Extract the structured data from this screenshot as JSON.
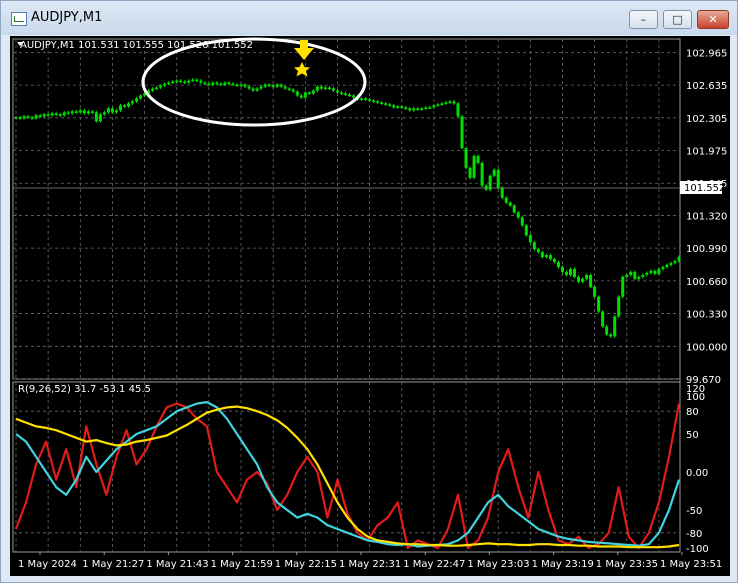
{
  "window": {
    "title": "AUDJPY,M1",
    "minimize_glyph": "–",
    "maximize_glyph": "□",
    "close_glyph": "✕"
  },
  "chart_data": [
    {
      "type": "candlestick",
      "title": "AUDJPY,M1  101.531 101.555 101.526 101.552",
      "ylim": [
        99.67,
        103.1
      ],
      "y_ticks": [
        "102.965",
        "102.635",
        "102.305",
        "101.975",
        "101.645",
        "101.320",
        "100.990",
        "100.660",
        "100.330",
        "100.000",
        "99.670"
      ],
      "current_price": "101.552",
      "series": [
        {
          "color": "#00e000",
          "x": [
            0,
            4,
            8,
            12,
            16,
            20,
            24,
            28,
            32,
            36,
            40,
            44,
            48,
            52,
            56,
            60,
            64,
            68,
            72,
            76,
            80,
            84,
            88,
            92,
            96,
            100,
            104,
            108,
            112,
            116,
            120,
            124,
            128,
            132,
            136,
            140,
            144,
            148,
            152,
            156,
            160,
            164,
            168,
            172,
            176,
            180,
            184,
            188,
            192,
            196,
            200,
            204,
            208,
            212,
            216,
            220,
            224,
            228,
            232,
            236,
            240,
            244,
            248,
            252,
            256,
            260,
            264,
            268,
            272,
            276,
            280,
            284,
            288,
            292,
            296,
            300,
            304,
            308,
            312,
            316,
            320,
            324,
            328,
            332,
            336,
            340,
            344,
            348,
            352,
            356,
            360,
            364,
            368,
            372,
            376,
            380,
            384,
            388,
            392,
            396,
            400,
            404,
            408,
            412,
            416,
            420,
            424,
            428,
            432,
            436,
            440,
            444,
            448,
            452,
            456,
            460,
            464,
            468,
            472,
            476,
            480,
            484,
            488,
            492,
            496,
            500,
            504,
            508,
            512,
            516,
            520,
            524,
            528,
            532,
            536,
            540,
            544,
            548,
            552,
            556,
            560,
            564,
            568,
            572,
            576,
            580,
            584,
            588,
            592,
            596,
            600,
            604,
            608,
            612,
            616,
            620,
            624,
            628,
            632,
            636,
            640,
            644,
            648,
            652,
            656,
            660
          ],
          "values": [
            102.31,
            102.3,
            102.32,
            102.31,
            102.3,
            102.33,
            102.32,
            102.34,
            102.33,
            102.35,
            102.34,
            102.33,
            102.36,
            102.35,
            102.37,
            102.36,
            102.38,
            102.35,
            102.37,
            102.36,
            102.27,
            102.34,
            102.36,
            102.4,
            102.36,
            102.38,
            102.43,
            102.42,
            102.45,
            102.47,
            102.5,
            102.53,
            102.55,
            102.58,
            102.6,
            102.61,
            102.63,
            102.65,
            102.66,
            102.67,
            102.68,
            102.67,
            102.66,
            102.68,
            102.69,
            102.68,
            102.66,
            102.65,
            102.64,
            102.66,
            102.65,
            102.64,
            102.66,
            102.65,
            102.64,
            102.63,
            102.64,
            102.62,
            102.6,
            102.58,
            102.6,
            102.62,
            102.64,
            102.63,
            102.62,
            102.64,
            102.62,
            102.6,
            102.59,
            102.57,
            102.53,
            102.51,
            102.56,
            102.55,
            102.58,
            102.62,
            102.6,
            102.61,
            102.6,
            102.58,
            102.56,
            102.55,
            102.54,
            102.53,
            102.51,
            102.49,
            102.5,
            102.49,
            102.48,
            102.47,
            102.46,
            102.45,
            102.44,
            102.43,
            102.41,
            102.42,
            102.41,
            102.4,
            102.38,
            102.4,
            102.39,
            102.4,
            102.41,
            102.41,
            102.43,
            102.44,
            102.45,
            102.46,
            102.47,
            102.45,
            102.32,
            102.0,
            101.8,
            101.7,
            101.92,
            101.85,
            101.62,
            101.58,
            101.72,
            101.78,
            101.6,
            101.5,
            101.45,
            101.42,
            101.35,
            101.3,
            101.22,
            101.12,
            101.05,
            100.98,
            100.95,
            100.9,
            100.92,
            100.88,
            100.85,
            100.8,
            100.75,
            100.72,
            100.78,
            100.7,
            100.65,
            100.68,
            100.72,
            100.6,
            100.5,
            100.35,
            100.2,
            100.12,
            100.1,
            100.3,
            100.5,
            100.7,
            100.72,
            100.75,
            100.68,
            100.7,
            100.72,
            100.74,
            100.76,
            100.73,
            100.78,
            100.8,
            100.82,
            100.84,
            100.86,
            100.9
          ]
        }
      ],
      "annotation": {
        "shape": "ellipse",
        "arrow_color": "#ffe000",
        "star_color": "#ffe000"
      }
    },
    {
      "type": "line",
      "title": "R(9,26,52) 31.7 -53.1 45.5",
      "ylim": [
        -100,
        100
      ],
      "y_ticks": [
        "120",
        "100",
        "80",
        "50",
        "0.00",
        "-50",
        "-80",
        "-100"
      ],
      "x_ticks": [
        "1 May 2024",
        "1 May 21:27",
        "1 May 21:43",
        "1 May 21:59",
        "1 May 22:15",
        "1 May 22:31",
        "1 May 22:47",
        "1 May 23:03",
        "1 May 23:19",
        "1 May 23:35",
        "1 May 23:51"
      ],
      "series": [
        {
          "color": "#e31b1b",
          "x": [
            0,
            10,
            20,
            30,
            40,
            50,
            60,
            70,
            80,
            90,
            100,
            110,
            120,
            130,
            140,
            150,
            160,
            170,
            180,
            190,
            200,
            210,
            220,
            230,
            240,
            250,
            260,
            270,
            280,
            290,
            300,
            310,
            320,
            330,
            340,
            350,
            360,
            370,
            380,
            390,
            400,
            410,
            420,
            430,
            440,
            450,
            460,
            470,
            480,
            490,
            500,
            510,
            520,
            530,
            540,
            550,
            560,
            570,
            580,
            590,
            600,
            610,
            620,
            630,
            640,
            650,
            660
          ],
          "values": [
            -75,
            -40,
            10,
            40,
            -10,
            30,
            -20,
            60,
            10,
            -30,
            20,
            55,
            10,
            30,
            60,
            85,
            90,
            85,
            70,
            60,
            0,
            -20,
            -40,
            -10,
            0,
            -15,
            -50,
            -30,
            0,
            20,
            0,
            -60,
            -10,
            -55,
            -80,
            -90,
            -70,
            -60,
            -40,
            -100,
            -90,
            -95,
            -100,
            -75,
            -30,
            -100,
            -90,
            -60,
            0,
            30,
            -20,
            -60,
            0,
            -50,
            -90,
            -95,
            -85,
            -100,
            -95,
            -80,
            -20,
            -85,
            -100,
            -80,
            -40,
            20,
            90
          ]
        },
        {
          "color": "#3fd3e0",
          "x": [
            0,
            10,
            20,
            30,
            40,
            50,
            60,
            70,
            80,
            90,
            100,
            110,
            120,
            130,
            140,
            150,
            160,
            170,
            180,
            190,
            200,
            210,
            220,
            230,
            240,
            250,
            260,
            270,
            280,
            290,
            300,
            310,
            320,
            330,
            340,
            350,
            360,
            370,
            380,
            390,
            400,
            410,
            420,
            430,
            440,
            450,
            460,
            470,
            480,
            490,
            500,
            510,
            520,
            530,
            540,
            550,
            560,
            570,
            580,
            590,
            600,
            610,
            620,
            630,
            640,
            650,
            660
          ],
          "values": [
            50,
            40,
            20,
            0,
            -20,
            -30,
            -10,
            20,
            0,
            15,
            30,
            40,
            50,
            55,
            60,
            70,
            80,
            85,
            90,
            92,
            85,
            70,
            50,
            30,
            10,
            -20,
            -40,
            -50,
            -60,
            -55,
            -60,
            -70,
            -75,
            -80,
            -85,
            -90,
            -92,
            -95,
            -96,
            -95,
            -98,
            -97,
            -96,
            -95,
            -90,
            -80,
            -60,
            -40,
            -30,
            -45,
            -55,
            -65,
            -75,
            -80,
            -85,
            -88,
            -90,
            -92,
            -93,
            -94,
            -95,
            -96,
            -97,
            -95,
            -80,
            -50,
            -10
          ]
        },
        {
          "color": "#ffe000",
          "x": [
            0,
            10,
            20,
            30,
            40,
            50,
            60,
            70,
            80,
            90,
            100,
            110,
            120,
            130,
            140,
            150,
            160,
            170,
            180,
            190,
            200,
            210,
            220,
            230,
            240,
            250,
            260,
            270,
            280,
            290,
            300,
            310,
            320,
            330,
            340,
            350,
            360,
            370,
            380,
            390,
            400,
            410,
            420,
            430,
            440,
            450,
            460,
            470,
            480,
            490,
            500,
            510,
            520,
            530,
            540,
            550,
            560,
            570,
            580,
            590,
            600,
            610,
            620,
            630,
            640,
            650,
            660
          ],
          "values": [
            70,
            65,
            60,
            58,
            55,
            50,
            45,
            40,
            42,
            38,
            35,
            36,
            40,
            42,
            45,
            48,
            55,
            62,
            70,
            78,
            82,
            85,
            86,
            84,
            80,
            75,
            68,
            58,
            45,
            30,
            10,
            -15,
            -40,
            -60,
            -75,
            -85,
            -90,
            -92,
            -94,
            -95,
            -95,
            -96,
            -96,
            -97,
            -97,
            -96,
            -95,
            -94,
            -95,
            -95,
            -96,
            -96,
            -95,
            -95,
            -96,
            -96,
            -97,
            -97,
            -98,
            -98,
            -98,
            -99,
            -99,
            -99,
            -99,
            -98,
            -96
          ]
        }
      ]
    }
  ]
}
